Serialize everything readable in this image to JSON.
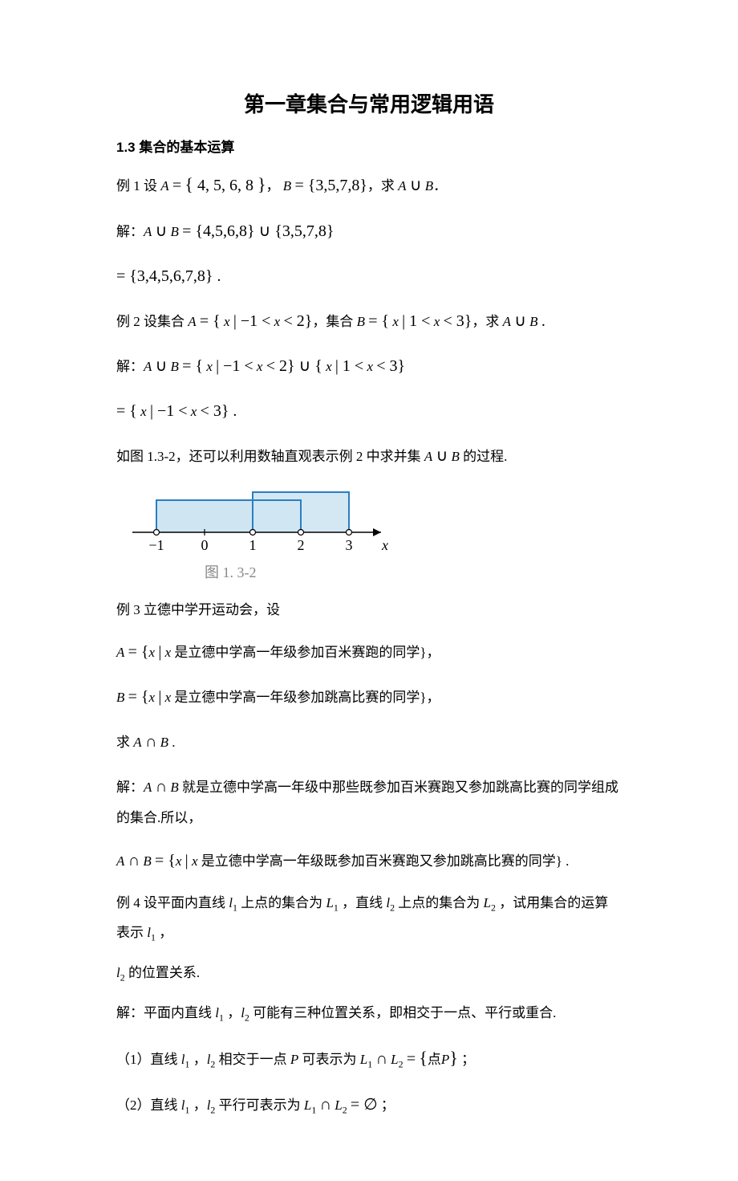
{
  "title": "第一章集合与常用逻辑用语",
  "section": "1.3 集合的基本运算",
  "ex1": {
    "prompt_pre": "例 1 设 ",
    "setA": "A = { 4, 5, 6, 8 }",
    "sep": "， ",
    "setB": "B = {3,5,7,8}",
    "prompt_post": "，求 A ∪ B ",
    "period": "．",
    "sol_label": "解：",
    "union_expr": "A ∪ B = {4,5,6,8} ∪ {3,5,7,8}",
    "result": "= {3,4,5,6,7,8} ."
  },
  "ex2": {
    "prompt_pre": "例 2 设集合 ",
    "setA": "A = { x | −1 < x < 2}",
    "mid": "，集合 ",
    "setB": "B = { x | 1 < x < 3}",
    "prompt_post": "，求 A ∪ B .",
    "sol_label": "解：",
    "union_expr": "A ∪ B = { x | −1 < x < 2} ∪ { x | 1 < x < 3}",
    "result": "= { x | −1 < x < 3} .",
    "note_pre": "如图 1.3-2，还可以利用数轴直观表示例 2 中求并集 ",
    "note_math": "A ∪ B",
    "note_post": " 的过程."
  },
  "figure": {
    "ticks": [
      "−1",
      "0",
      "1",
      "2",
      "3"
    ],
    "xlabel": "x",
    "caption": "图 1. 3-2"
  },
  "ex3": {
    "prompt": "例 3 立德中学开运动会，设",
    "setA_pre": "A = {x | x",
    "setA_text": " 是立德中学高一年级参加百米赛跑的同学}，",
    "setB_pre": "B = {x | x",
    "setB_text": " 是立德中学高一年级参加跳高比赛的同学}，",
    "ask_pre": "求 ",
    "ask_math": "A ∩ B",
    "ask_post": " .",
    "sol_label": "解：",
    "sol_math": "A ∩ B",
    "sol_text": " 就是立德中学高一年级中那些既参加百米赛跑又参加跳高比赛的同学组成的集合.所以，",
    "ans_pre": "A ∩ B = {x | x",
    "ans_text": " 是立德中学高一年级既参加百米赛跑又参加跳高比赛的同学} ."
  },
  "ex4": {
    "prompt_p1": "例 4 设平面内直线 ",
    "l1": "l₁",
    "prompt_p2": " 上点的集合为 ",
    "L1": "L₁",
    "prompt_p3": " ，直线 ",
    "l2": "l₂",
    "prompt_p4": " 上点的集合为 ",
    "L2": "L₂",
    "prompt_p5": " ，试用集合的运算表示 ",
    "prompt_p6": " ，",
    "line2_post": " 的位置关系.",
    "sol_label": "解：平面内直线 ",
    "sol_mid": " ，",
    "sol_post": " 可能有三种位置关系，即相交于一点、平行或重合.",
    "case1_pre": "（1）直线 ",
    "case1_mid": " ，",
    "case1_p2": " 相交于一点 ",
    "P": "P",
    "case1_p3": " 可表示为 ",
    "case1_expr_lhs": "L₁ ∩ L₂ = ",
    "case1_expr_rhs": "{点P}",
    "case1_end": " ；",
    "case2_pre": "（2）直线 ",
    "case2_mid": " ，",
    "case2_p2": " 平行可表示为 ",
    "case2_expr": "L₁ ∩ L₂ = ∅",
    "case2_end": " ；"
  }
}
